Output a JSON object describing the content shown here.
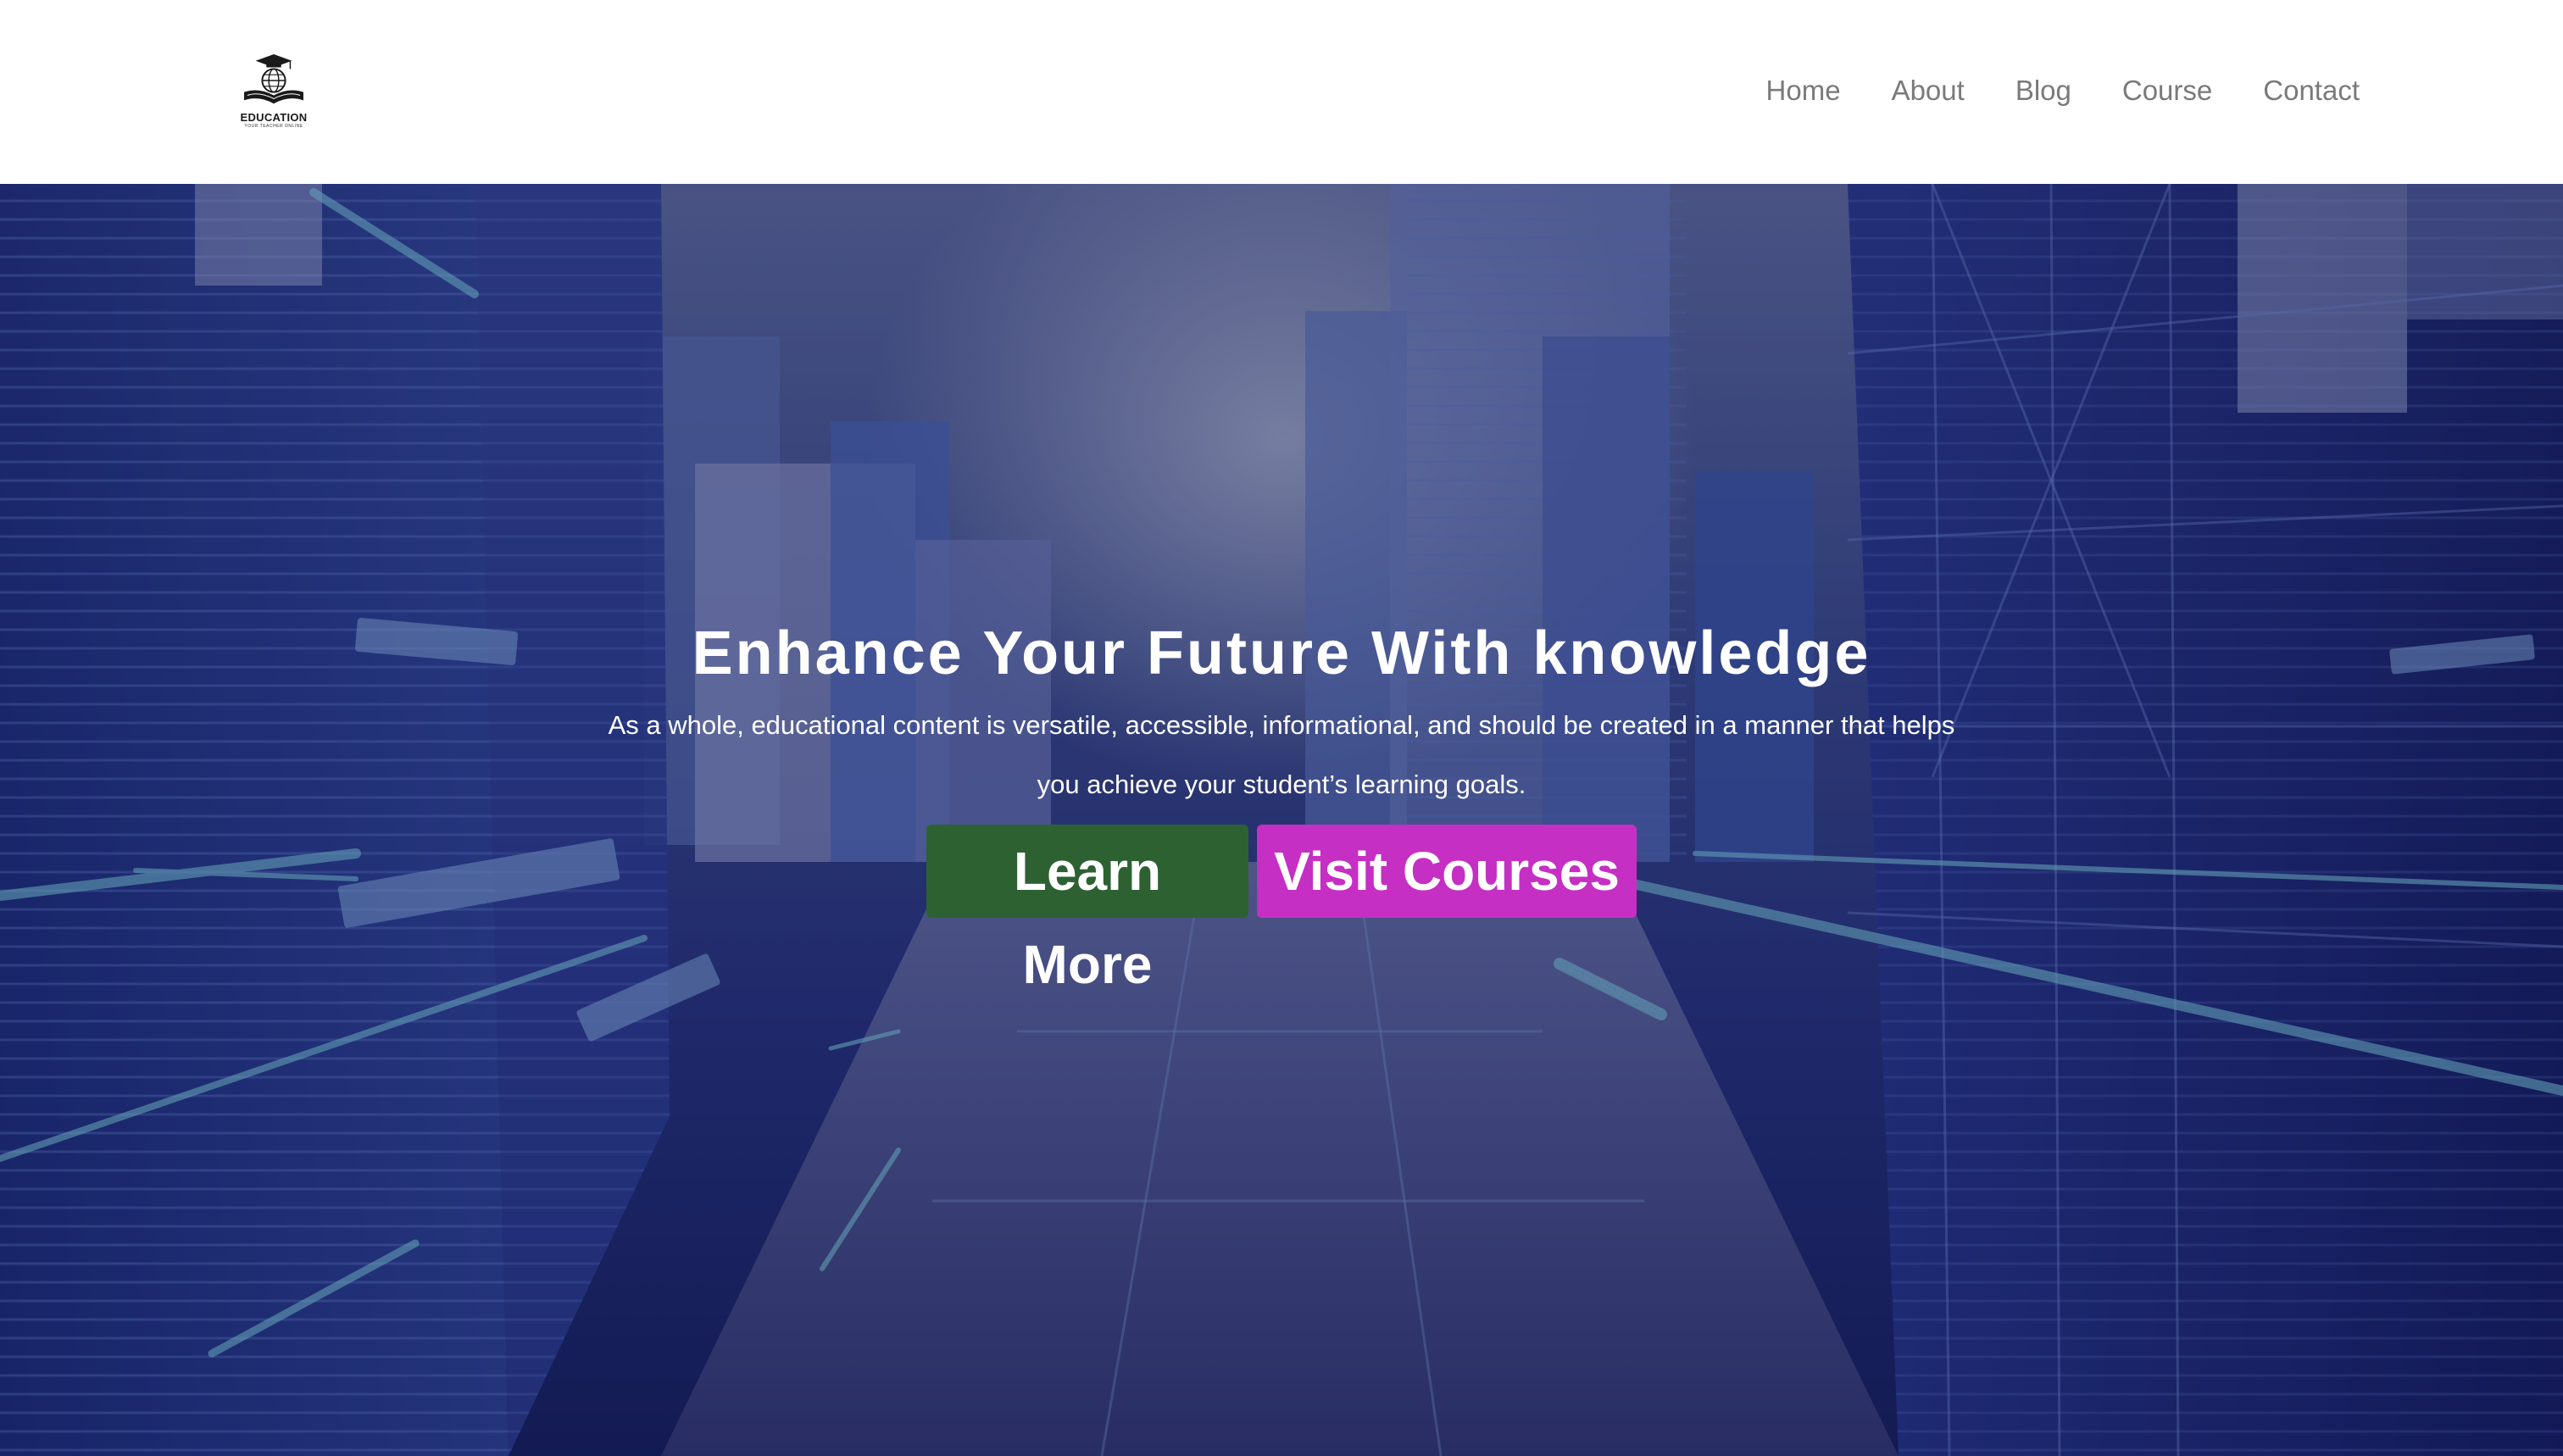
{
  "header": {
    "logo": {
      "title": "EDUCATION",
      "tagline": "YOUR TEACHER ONLINE",
      "icon": "graduation-cap-globe-book-icon"
    },
    "nav": [
      {
        "label": "Home"
      },
      {
        "label": "About"
      },
      {
        "label": "Blog"
      },
      {
        "label": "Course"
      },
      {
        "label": "Contact"
      }
    ]
  },
  "hero": {
    "title": "Enhance Your Future With knowledge",
    "subtitle": "As a whole, educational content is versatile, accessible, informational, and should be created in a manner that helps you achieve your student’s learning goals.",
    "buttons": {
      "learn_more": "Learn More",
      "visit_courses": "Visit Courses"
    },
    "background": "futuristic-city-skyline-image"
  },
  "colors": {
    "nav_text": "#7a7a7a",
    "learn_more_bg": "#2e6132",
    "visit_courses_bg": "#c62fc3",
    "hero_overlay": "#1a2260"
  }
}
